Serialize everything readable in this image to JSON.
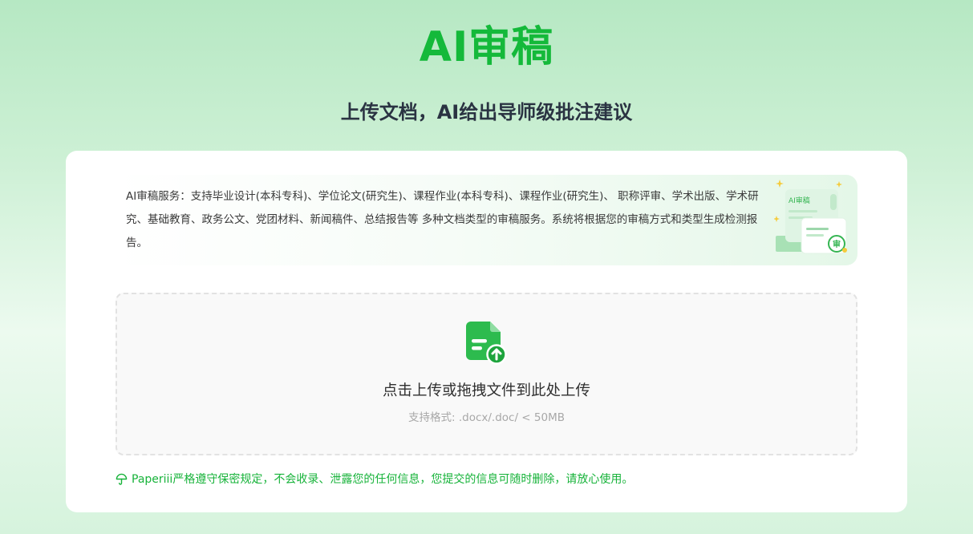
{
  "header": {
    "title": "AI审稿",
    "subtitle": "上传文档，AI给出导师级批注建议"
  },
  "info_banner": {
    "text": "AI审稿服务：支持毕业设计(本科专科)、学位论文(研究生)、课程作业(本科专科)、课程作业(研究生)、 职称评审、学术出版、学术研究、基础教育、政务公文、党团材料、新闻稿件、总结报告等 多种文档类型的审稿服务。系统将根据您的审稿方式和类型生成检测报告。",
    "illustration_label": "AI审稿",
    "illustration_badge": "审"
  },
  "upload": {
    "icon": "file-upload-icon",
    "prompt": "点击上传或拖拽文件到此处上传",
    "formats": "支持格式: .docx/.doc/ < 50MB"
  },
  "privacy": {
    "icon": "umbrella-icon",
    "text": "Paperiii严格遵守保密规定，不会收录、泄露您的任何信息，您提交的信息可随时删除，请放心使用。"
  },
  "colors": {
    "brand_green": "#14b93a",
    "title_dark": "#2a3342",
    "dashed_border": "#e2e2e2"
  }
}
